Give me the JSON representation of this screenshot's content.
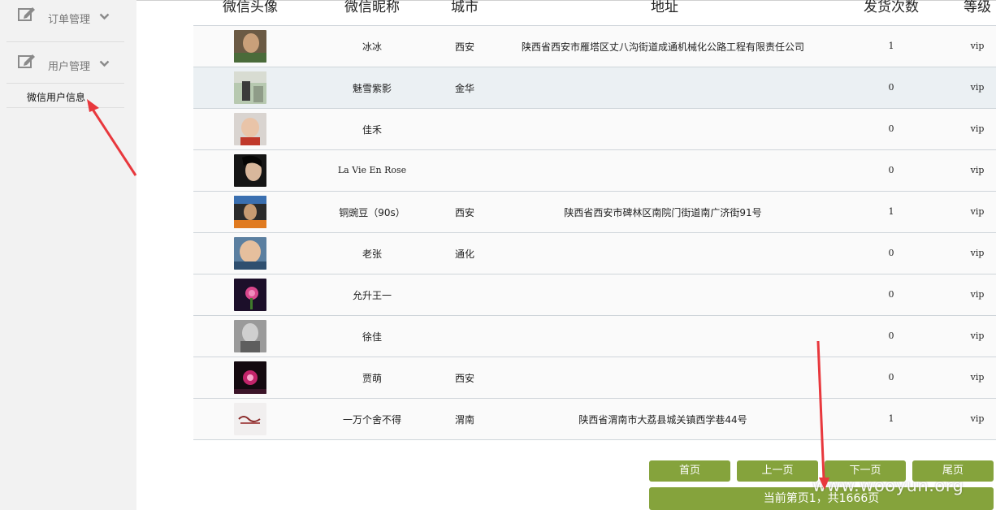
{
  "sidebar": {
    "groups": [
      {
        "label": "订单管理",
        "icon": "edit-icon"
      },
      {
        "label": "用户管理",
        "icon": "edit-icon"
      }
    ],
    "submenu": {
      "label": "微信用户信息"
    }
  },
  "table": {
    "headers": [
      "微信头像",
      "微信昵称",
      "城市",
      "地址",
      "发货次数",
      "等级"
    ],
    "rows": [
      {
        "nickname": "冰冰",
        "city": "西安",
        "address": "陕西省西安市雁塔区丈八沟街道成通机械化公路工程有限责任公司",
        "shipments": "1",
        "level": "vip"
      },
      {
        "nickname": "魅雪紫影",
        "city": "金华",
        "address": "",
        "shipments": "0",
        "level": "vip"
      },
      {
        "nickname": "佳禾",
        "city": "",
        "address": "",
        "shipments": "0",
        "level": "vip"
      },
      {
        "nickname": "La Vie En Rose",
        "city": "",
        "address": "",
        "shipments": "0",
        "level": "vip"
      },
      {
        "nickname": "铜豌豆（90s）",
        "city": "西安",
        "address": "陕西省西安市碑林区南院门街道南广济街91号",
        "shipments": "1",
        "level": "vip"
      },
      {
        "nickname": "老张",
        "city": "通化",
        "address": "",
        "shipments": "0",
        "level": "vip"
      },
      {
        "nickname": "允升王一",
        "city": "",
        "address": "",
        "shipments": "0",
        "level": "vip"
      },
      {
        "nickname": "徐佳",
        "city": "",
        "address": "",
        "shipments": "0",
        "level": "vip"
      },
      {
        "nickname": "贾萌",
        "city": "西安",
        "address": "",
        "shipments": "0",
        "level": "vip"
      },
      {
        "nickname": "一万个舍不得",
        "city": "渭南",
        "address": "陕西省渭南市大荔县城关镇西学巷44号",
        "shipments": "1",
        "level": "vip"
      }
    ]
  },
  "pagination": {
    "first": "首页",
    "prev": "上一页",
    "next": "下一页",
    "last": "尾页",
    "info": "当前第页1，共1666页"
  },
  "watermark": "www.wooyun.org",
  "colors": {
    "accent": "#85a33c",
    "annotation_arrow": "#e8383d"
  }
}
